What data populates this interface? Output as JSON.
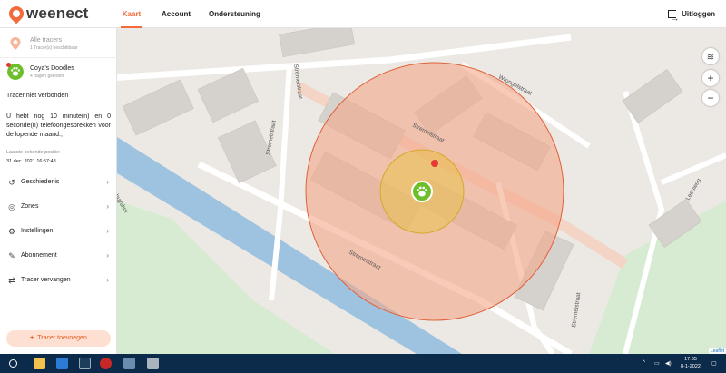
{
  "app": {
    "logo_text": "weenect"
  },
  "nav": {
    "tabs": [
      {
        "label": "Kaart"
      },
      {
        "label": "Account"
      },
      {
        "label": "Ondersteuning"
      }
    ],
    "logout_label": "Uitloggen"
  },
  "sidebar": {
    "all_trackers": {
      "title": "Alle tracers",
      "subtitle": "1 Tracer(s) beschikbaar"
    },
    "tracker": {
      "name": "Coya's Doodles",
      "last_seen": "4 dagen geleden"
    },
    "status": "Tracer niet verbonden",
    "minutes_notice": "U hebt nog 10 minute(n) en 0 seconde(n) telefoongesprekken voor de lopende maand.;",
    "last_position_label": "Laatste bekende positie:",
    "last_position_value": "31 dec. 2021 16:57:48",
    "menu": [
      {
        "label": "Geschiedenis",
        "icon": "history-icon"
      },
      {
        "label": "Zones",
        "icon": "zone-icon"
      },
      {
        "label": "Instellingen",
        "icon": "settings-icon"
      },
      {
        "label": "Abonnement",
        "icon": "subscription-icon"
      },
      {
        "label": "Tracer vervangen",
        "icon": "replace-icon"
      }
    ],
    "add_button": "Tracer toevoegen"
  },
  "map": {
    "street_labels": [
      "Wrongelstraat",
      "Stremelstraat",
      "Stremelstraat",
      "Stremelstraat",
      "Stremelstraat",
      "Stremelstraat",
      "tershuyshof",
      "Leeuweg"
    ],
    "attribution": "Leaflet",
    "colors": {
      "accent": "#f26b3a",
      "outer_zone": "#f3a689",
      "inner_zone": "#e8c24b",
      "tracker": "#6cbf2a",
      "water": "#9ec3e0",
      "park": "#d6ebd2"
    }
  },
  "taskbar": {
    "time": "17:35",
    "date": "8-1-2022"
  }
}
